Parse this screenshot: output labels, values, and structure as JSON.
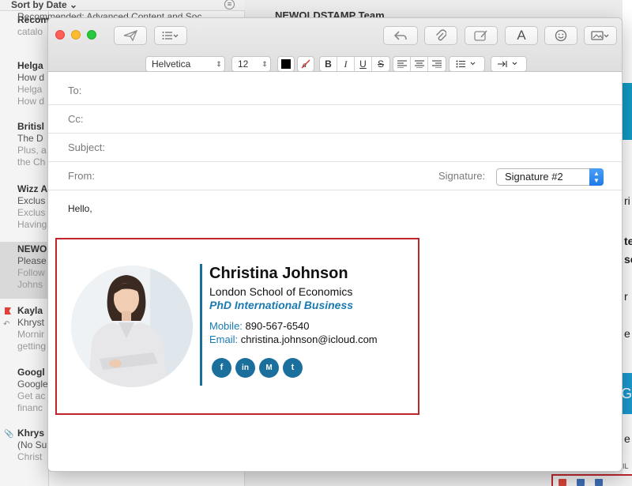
{
  "background": {
    "sort_label": "Sort by Date ⌄",
    "top_preview": "Recommended: Advanced Content and Soc",
    "reading_sender": "NEWOLDSTAMP Team",
    "messages": [
      {
        "sender": "Recom",
        "lines": [
          "catalo"
        ]
      },
      {
        "sender": "Helga",
        "lines": [
          "How d",
          "Helga",
          "How d"
        ]
      },
      {
        "sender": "Britisl",
        "lines": [
          "The D",
          "Plus, a",
          "the Ch"
        ]
      },
      {
        "sender": "Wizz A",
        "lines": [
          "Exclus",
          "Exclus",
          "Having"
        ]
      },
      {
        "sender": "NEWO",
        "lines": [
          "Please",
          "Follow",
          "Johns"
        ]
      },
      {
        "sender": "Kayla",
        "lines": [
          "Khryst",
          "Mornir",
          "getting"
        ]
      },
      {
        "sender": "Googl",
        "lines": [
          "Google",
          "Get ac",
          "financ"
        ]
      },
      {
        "sender": "Khrys",
        "lines": [
          "(No Su",
          "Christ"
        ]
      }
    ],
    "right_fragments": [
      "ri",
      "te",
      "se",
      "r",
      "e",
      "Ge",
      "e",
      "AIL"
    ]
  },
  "compose": {
    "format": {
      "font": "Helvetica",
      "size": "12",
      "bold": "B",
      "italic": "I",
      "underline": "U",
      "strike": "S"
    },
    "toolbar_icons": [
      "send-icon",
      "list-icon",
      "reply-icon",
      "attach-icon",
      "markup-icon",
      "font-icon",
      "emoji-icon",
      "photo-icon"
    ],
    "font_button": "A",
    "fields": {
      "to": "To:",
      "cc": "Cc:",
      "subject": "Subject:",
      "from": "From:",
      "signature_label": "Signature:",
      "signature_value": "Signature #2"
    },
    "body_text": "Hello,"
  },
  "signature": {
    "name": "Christina Johnson",
    "school": "London School of Economics",
    "title": "PhD International Business",
    "mobile_label": "Mobile:",
    "mobile": "890-567-6540",
    "email_label": "Email:",
    "email": "christina.johnson@icloud.com",
    "socials": [
      {
        "icon": "facebook-icon",
        "glyph": "f"
      },
      {
        "icon": "linkedin-icon",
        "glyph": "in"
      },
      {
        "icon": "medium-icon",
        "glyph": "M"
      },
      {
        "icon": "twitter-icon",
        "glyph": "t"
      }
    ],
    "accent": "#1a6f9c",
    "frame_color": "#c0272d"
  }
}
